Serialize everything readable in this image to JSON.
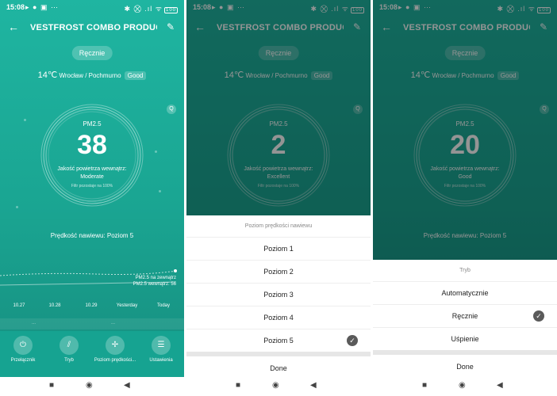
{
  "status_bar": {
    "time": "15:08",
    "left_icons": "▸ ● ▣ ⋯",
    "right_icons": "✱ ⛒ .ıl ᯤ",
    "battery": "100"
  },
  "app": {
    "title": "VESTFROST COMBO PRODUC...",
    "back_icon": "back-arrow-icon",
    "edit_icon": "edit-icon"
  },
  "mode_pill": "Ręcznie",
  "weather": {
    "temp": "14℃",
    "location": "Wrocław / Pochmurno",
    "quality": "Good"
  },
  "ring_label": "PM2.5",
  "quality_label": "Jakość powietrza wewnątrz:",
  "filter_text": "Filtr pozostaje na 100%",
  "fan_speed": "Prędkość nawiewu: Poziom 5",
  "panels": [
    {
      "pm_value": "38",
      "level": "Moderate"
    },
    {
      "pm_value": "2",
      "level": "Excellent"
    },
    {
      "pm_value": "20",
      "level": "Good"
    }
  ],
  "chart": {
    "legend_outdoor": "PM2.5 na zewnątrz",
    "legend_indoor": "PM2.5 wewnątrz: 56",
    "ticks": [
      "10.27",
      "10.28",
      "10.29",
      "Yesterday",
      "Today"
    ]
  },
  "tabs_strip": {
    "left": "...",
    "right": "..."
  },
  "bottom_actions": [
    {
      "label": "Przełącznik",
      "icon": "power-icon"
    },
    {
      "label": "Tryb",
      "icon": "mode-icon"
    },
    {
      "label": "Poziom prędkości...",
      "icon": "fan-icon"
    },
    {
      "label": "Ustawienia",
      "icon": "settings-icon"
    }
  ],
  "speed_sheet": {
    "title": "Poziom prędkości nawiewu",
    "options": [
      "Poziom 1",
      "Poziom 2",
      "Poziom 3",
      "Poziom 4",
      "Poziom 5"
    ],
    "selected": "Poziom 5",
    "done": "Done"
  },
  "mode_sheet": {
    "title": "Tryb",
    "options": [
      "Automatycznie",
      "Ręcznie",
      "Uśpienie"
    ],
    "selected": "Ręcznie",
    "done": "Done"
  },
  "colors": {
    "teal": "#1fb5a1",
    "teal_dark": "#16a391"
  }
}
